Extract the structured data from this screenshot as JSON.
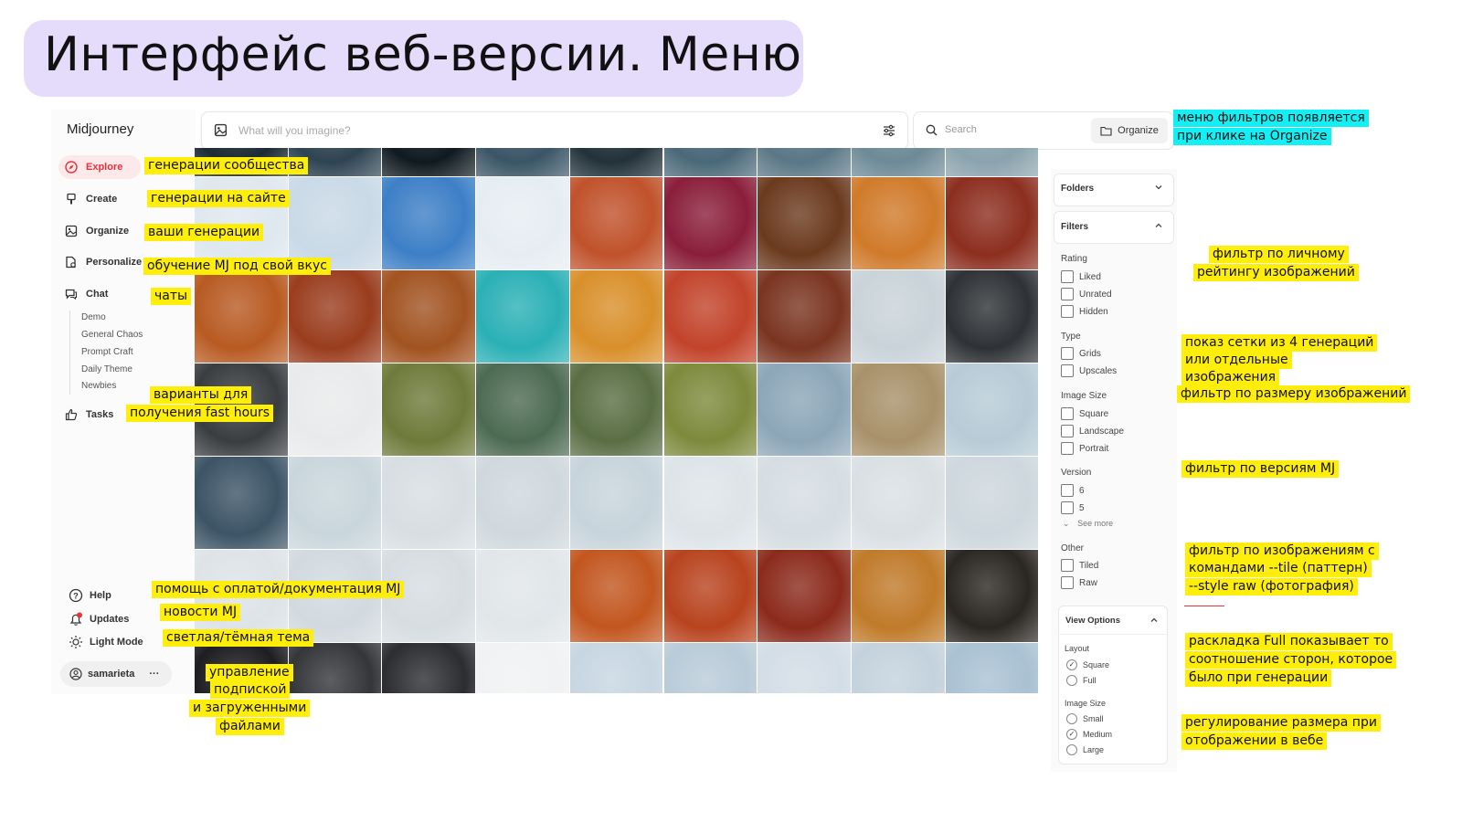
{
  "slide_title": "Интерфейс веб-версии. Меню",
  "sidebar": {
    "brand": "Midjourney",
    "nav": [
      {
        "label": "Explore",
        "icon": "compass-icon"
      },
      {
        "label": "Create",
        "icon": "brush-icon"
      },
      {
        "label": "Organize",
        "icon": "image-icon"
      },
      {
        "label": "Personalize",
        "icon": "personalize-icon"
      },
      {
        "label": "Chat",
        "icon": "chat-icon"
      }
    ],
    "chat_rooms": [
      "Demo",
      "General Chaos",
      "Prompt Craft",
      "Daily Theme",
      "Newbies"
    ],
    "tasks": {
      "label": "Tasks",
      "icon": "thumbs-up-icon"
    },
    "bottom": [
      {
        "label": "Help",
        "icon": "help-icon"
      },
      {
        "label": "Updates",
        "icon": "bell-icon"
      },
      {
        "label": "Light Mode",
        "icon": "sun-icon"
      }
    ],
    "user": "samarieta",
    "user_menu": "···"
  },
  "prompt_bar": {
    "placeholder": "What will you imagine?",
    "icon": "image-icon",
    "settings_icon": "sliders-icon"
  },
  "search_bar": {
    "placeholder": "Search",
    "icon": "search-icon",
    "organize_label": "Organize",
    "organize_icon": "folder-icon"
  },
  "filters_panel": {
    "folders_label": "Folders",
    "filters_label": "Filters",
    "groups": [
      {
        "title": "Rating",
        "options": [
          "Liked",
          "Unrated",
          "Hidden"
        ]
      },
      {
        "title": "Type",
        "options": [
          "Grids",
          "Upscales"
        ]
      },
      {
        "title": "Image Size",
        "options": [
          "Square",
          "Landscape",
          "Portrait"
        ]
      },
      {
        "title": "Version",
        "options": [
          "6",
          "5"
        ],
        "more": "See more"
      },
      {
        "title": "Other",
        "options": [
          "Tiled",
          "Raw"
        ]
      }
    ],
    "view_options_label": "View Options",
    "layout": {
      "title": "Layout",
      "options": [
        "Square",
        "Full"
      ],
      "selected": "Square"
    },
    "image_size": {
      "title": "Image Size",
      "options": [
        "Small",
        "Medium",
        "Large"
      ],
      "selected": "Medium"
    }
  },
  "annotations": {
    "explore": "генерации сообщества",
    "create": "генерации на сайте",
    "organize": "ваши генерации",
    "personalize": "обучение MJ под свой вкус",
    "chat": "чаты",
    "tasks_line1": "варианты для",
    "tasks_line2": "получения fast hours",
    "help": "помощь с оплатой/документация MJ",
    "updates": "новости MJ",
    "lightmode": "светлая/тёмная тема",
    "user_line1": "управление",
    "user_line2": "подпиской",
    "user_line3": "и загруженными",
    "user_line4": "файлами",
    "organize_menu_line1": "меню фильтров появляется",
    "organize_menu_line2": "при клике на Organize",
    "rating_line1": "фильтр по личному",
    "rating_line2": "рейтингу изображений",
    "type_line1": "показ сетки из 4 генераций",
    "type_line2": "или отдельные",
    "type_line3": "изображения",
    "size_filter": "фильтр по размеру изображений",
    "version_filter": "фильтр по версиям MJ",
    "other_line1": "фильтр по изображениям с",
    "other_line2": "командами --tile (паттерн)",
    "other_line3": "--style raw (фотография)",
    "layout_line1": "раскладка Full показывает то",
    "layout_line2": "соотношение сторон, которое",
    "layout_line3": "было при генерации",
    "imgsize_line1": "регулирование размера при",
    "imgsize_line2": "отображении в вебе"
  },
  "colors": {
    "title_bg": "#e5dcfb",
    "annotation_yellow": "#ffee0a",
    "annotation_cyan": "#12f0f5",
    "explore_accent": "#e8323c"
  }
}
